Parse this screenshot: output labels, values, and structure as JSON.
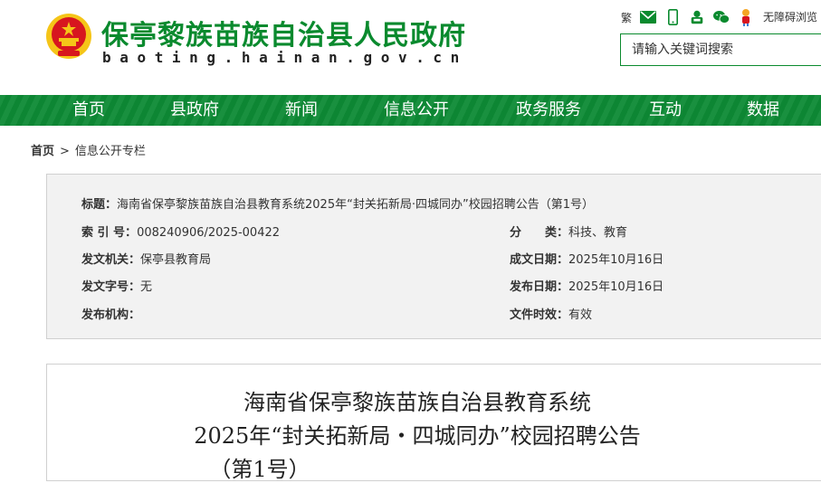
{
  "header": {
    "site_title": "保亭黎族苗族自治县人民政府",
    "site_domain": "baoting.hainan.gov.cn",
    "traditional_label": "繁",
    "accessibility_label": "无障碍浏览",
    "search_placeholder": "请输入关键词搜索",
    "icons": [
      "mail-icon",
      "mobile-icon",
      "app-icon",
      "wechat-icon",
      "mascot-icon"
    ]
  },
  "nav": {
    "items": [
      "首页",
      "县政府",
      "新闻",
      "信息公开",
      "政务服务",
      "互动",
      "数据"
    ]
  },
  "breadcrumb": {
    "home": "首页",
    "separator": ">",
    "current": "信息公开专栏"
  },
  "info": {
    "title_label": "标题：",
    "title_value": "海南省保亭黎族苗族自治县教育系统2025年“封关拓新局·四城同办”校园招聘公告（第1号）",
    "index_label": "索 引 号：",
    "index_value": "008240906/2025-00422",
    "category_label": "分　　类：",
    "category_value": "科技、教育",
    "issuer_label": "发文机关：",
    "issuer_value": "保亭县教育局",
    "created_label": "成文日期：",
    "created_value": "2025年10月16日",
    "doc_no_label": "发文字号：",
    "doc_no_value": "无",
    "published_label": "发布日期：",
    "published_value": "2025年10月16日",
    "agency_label": "发布机构：",
    "agency_value": "",
    "validity_label": "文件时效：",
    "validity_value": "有效"
  },
  "article": {
    "title_line1": "海南省保亭黎族苗族自治县教育系统",
    "title_line2": "2025年“封关拓新局・四城同办”校园招聘公告",
    "title_line3": "（第1号）"
  },
  "colors": {
    "brand_green": "#0a8a2e",
    "nav_green": "#0d8a35",
    "emblem_red": "#d7161f",
    "emblem_gold": "#f5c518"
  }
}
